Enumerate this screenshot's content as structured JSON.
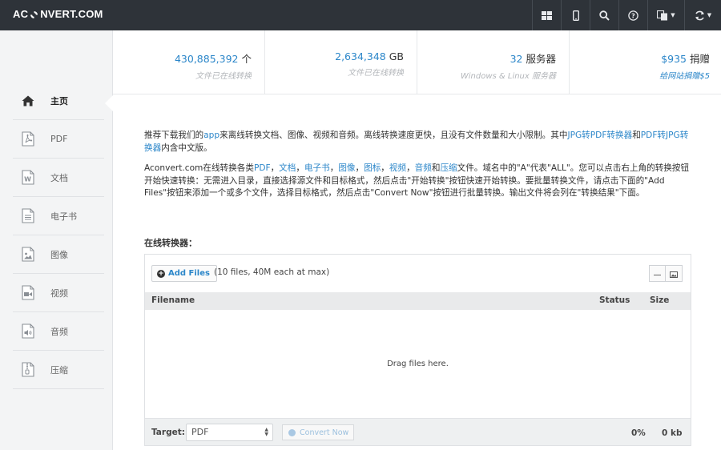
{
  "brand": {
    "logo_left": "AC",
    "logo_right": "NVERT.COM"
  },
  "navbar": {
    "icons": [
      "grid-icon",
      "mobile-icon",
      "search-icon",
      "help-icon",
      "language-icon",
      "refresh-icon"
    ]
  },
  "sidebar": {
    "items": [
      {
        "label": "主页",
        "icon": "home-icon",
        "active": true
      },
      {
        "label": "PDF",
        "icon": "pdf-file-icon"
      },
      {
        "label": "文档",
        "icon": "document-file-icon"
      },
      {
        "label": "电子书",
        "icon": "ebook-file-icon"
      },
      {
        "label": "图像",
        "icon": "image-file-icon"
      },
      {
        "label": "视频",
        "icon": "video-file-icon"
      },
      {
        "label": "音频",
        "icon": "audio-file-icon"
      },
      {
        "label": "压缩",
        "icon": "archive-file-icon"
      }
    ]
  },
  "stats": [
    {
      "value": "430,885,392",
      "unit": "个",
      "sub": "文件已在线转换"
    },
    {
      "value": "2,634,348",
      "unit": "GB",
      "sub": "文件已在线转换"
    },
    {
      "value": "32",
      "unit": "服务器",
      "sub": "Windows & Linux 服务器"
    },
    {
      "value": "$935",
      "unit": "捐赠",
      "sub": "给网站捐赠$5"
    }
  ],
  "intro": {
    "p1_a": "推荐下载我们的",
    "p1_link_app": "app",
    "p1_b": "来离线转换文档、图像、视频和音频。离线转换速度更快，且没有文件数量和大小限制。其中",
    "p1_link_jpg_pdf": "JPG转PDF转换器",
    "p1_c": "和",
    "p1_link_pdf_jpg": "PDF转JPG转换器",
    "p1_d": "内含中文版。",
    "p2_a": "Aconvert.com在线转换各类",
    "p2_links": [
      "PDF",
      "文档",
      "电子书",
      "图像",
      "图标",
      "视频",
      "音频",
      "压缩"
    ],
    "p2_sep": "，",
    "p2_and": "和",
    "p2_b": "文件。域名中的\"A\"代表\"ALL\"。您可以点击右上角的转换按钮开始快速转换：无需进入目录，直接选择源文件和目标格式，然后点击\"开始转换\"按钮快速开始转换。要批量转换文件，请点击下面的\"Add Files\"按钮来添加一个或多个文件，选择目标格式，然后点击\"Convert Now\"按钮进行批量转换。输出文件将会列在\"转换结果\"下面。"
  },
  "converter": {
    "section_title": "在线转换器：",
    "add_files_label": "Add Files",
    "limits_text": "(10 files, 40M each at max)",
    "columns": {
      "filename": "Filename",
      "status": "Status",
      "size": "Size"
    },
    "drop_text": "Drag files here.",
    "target_label": "Target:",
    "target_value": "PDF",
    "convert_label": "Convert Now",
    "progress": "0%",
    "total_size": "0 kb"
  },
  "colors": {
    "navbar": "#2e3339",
    "link": "#2b86c9",
    "accent": "#2b86c9"
  }
}
